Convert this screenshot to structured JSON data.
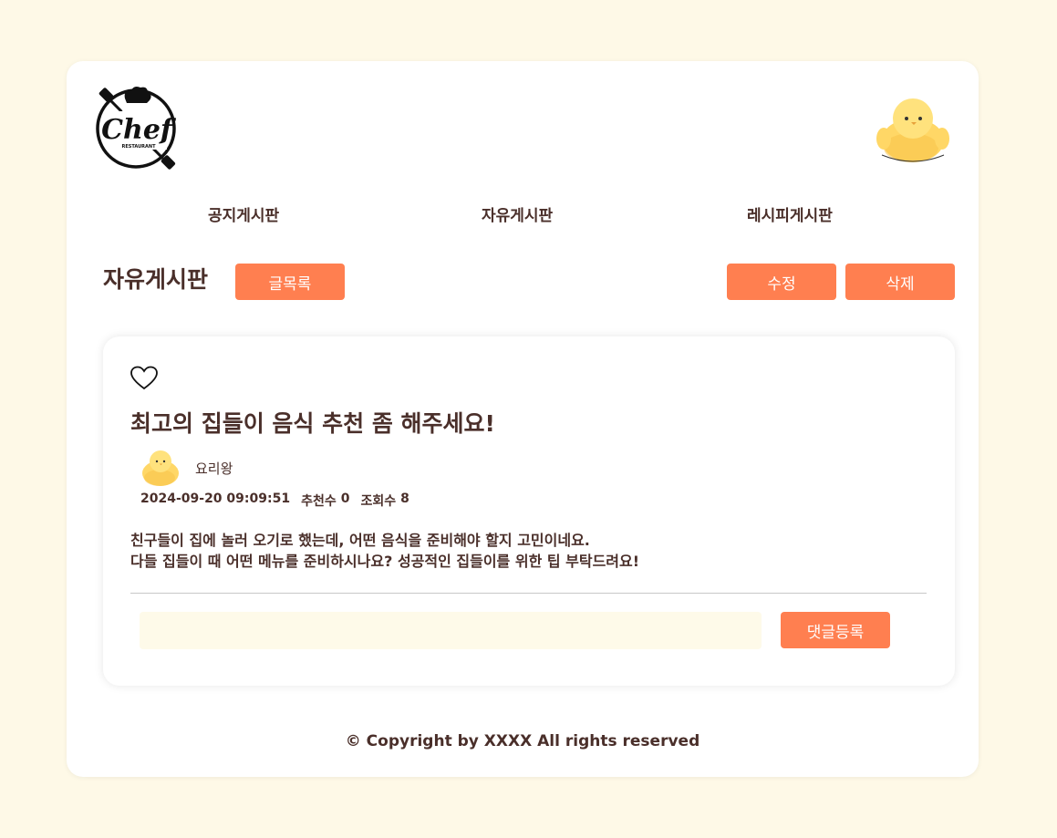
{
  "header": {
    "logo_icon": "chef-restaurant-logo",
    "logo_text": "Chef",
    "logo_subtext": "RESTAURANT",
    "profile_icon": "chick-avatar"
  },
  "nav": {
    "items": [
      {
        "label": "공지게시판"
      },
      {
        "label": "자유게시판"
      },
      {
        "label": "레시피게시판"
      }
    ]
  },
  "toolbar": {
    "board_title": "자유게시판",
    "list_label": "글목록",
    "edit_label": "수정",
    "delete_label": "삭제"
  },
  "post": {
    "like_icon": "heart-outline-icon",
    "title": "최고의 집들이 음식 추천 좀 해주세요!",
    "author": "요리왕",
    "date": "2024-09-20 09:09:51",
    "recommend_label": "추천수",
    "recommend_count": "0",
    "views_label": "조회수",
    "views_count": "8",
    "body_line1": "친구들이 집에 놀러 오기로 했는데, 어떤 음식을 준비해야 할지 고민이네요.",
    "body_line2": "다들 집들이 때 어떤 메뉴를 준비하시나요? 성공적인 집들이를 위한 팁 부탁드려요!"
  },
  "comment": {
    "input_value": "",
    "submit_label": "댓글등록"
  },
  "footer": {
    "copyright": "© Copyright by XXXX All rights reserved"
  },
  "colors": {
    "background": "#fef9e7",
    "accent": "#ff7f50",
    "text": "#4a2f2a"
  }
}
